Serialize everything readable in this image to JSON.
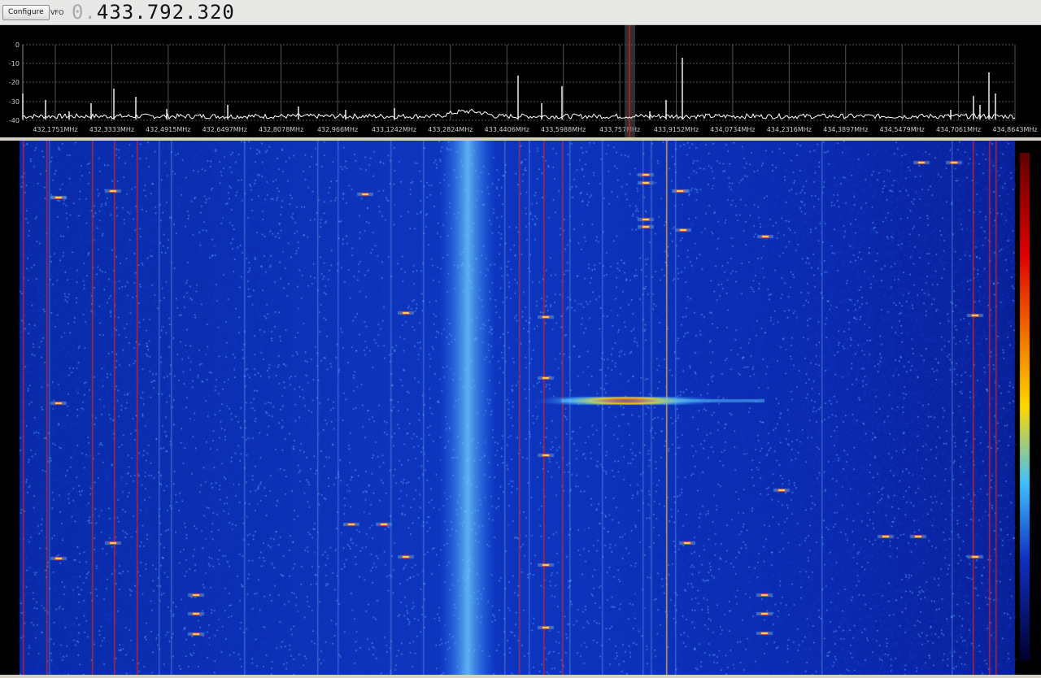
{
  "toolbar": {
    "configure_label": "Configure",
    "vfo_label": "VFO",
    "frequency_lead": "0.",
    "frequency_main": "433.792.320"
  },
  "spectrum": {
    "db_labels": [
      "0",
      "-10",
      "-20",
      "-30",
      "-40"
    ],
    "freq_labels": [
      "432,1751MHz",
      "432,3333MHz",
      "432,4915MHz",
      "432,6497MHz",
      "432,8078MHz",
      "432,966MHz",
      "433,1242MHz",
      "433,2824MHz",
      "433,4406MHz",
      "433,5988MHz",
      "433,757MHz",
      "433,9152MHz",
      "434,0734MHz",
      "434,2316MHz",
      "434,3897MHz",
      "434,5479MHz",
      "434,7061MHz",
      "434,8643MHz"
    ]
  },
  "colors": {
    "trace": "#ffffff",
    "grid": "#555555",
    "waterfall_base": "#0a1a9a",
    "marker": "#c02020"
  }
}
